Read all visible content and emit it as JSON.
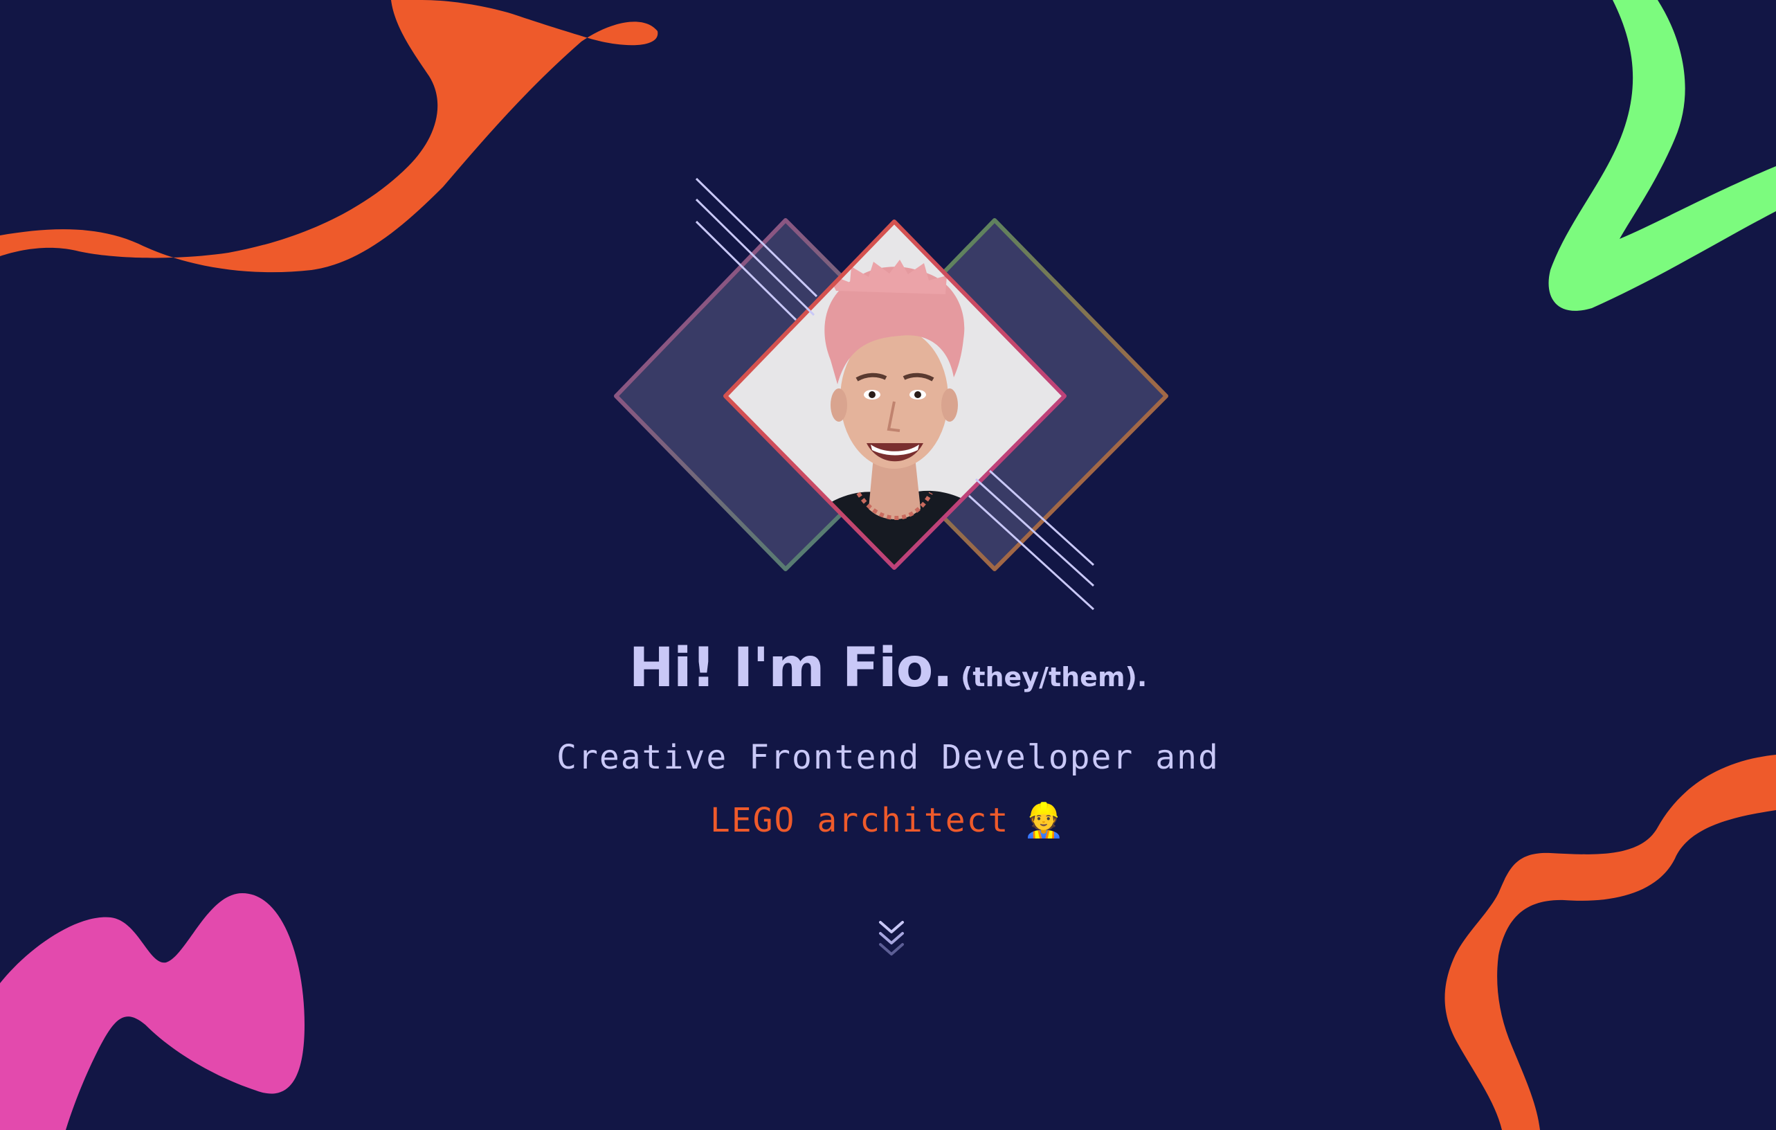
{
  "hero": {
    "greeting": "Hi! I'm Fio.",
    "pronouns": "(they/them).",
    "subtitle_line1": "Creative Frontend Developer and",
    "subtitle_highlight": "LEGO architect",
    "subtitle_emoji": "👷"
  },
  "icons": {
    "scroll_down": "chevrons-down-icon",
    "portrait": "profile-photo"
  },
  "colors": {
    "background": "#121645",
    "text": "#c9c8f7",
    "accent_orange": "#ee5a2b",
    "accent_green": "#7cfb7e",
    "accent_pink": "#e34aad",
    "diamond_fill": "#393b66"
  }
}
